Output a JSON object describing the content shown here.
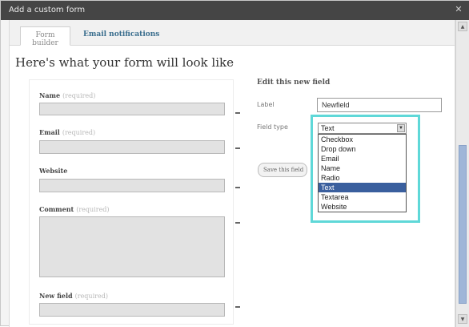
{
  "window": {
    "title": "Add a custom form",
    "close_glyph": "✕"
  },
  "tabs": [
    {
      "label": "Form builder"
    },
    {
      "label": "Email notifications"
    }
  ],
  "preview": {
    "heading": "Here's what your form will look like",
    "fields": [
      {
        "label": "Name",
        "required_text": "(required)"
      },
      {
        "label": "Email",
        "required_text": "(required)"
      },
      {
        "label": "Website",
        "required_text": ""
      },
      {
        "label": "Comment",
        "required_text": "(required)"
      },
      {
        "label": "New field",
        "required_text": "(required)"
      }
    ]
  },
  "editor": {
    "title": "Edit this new field",
    "label_caption": "Label",
    "label_value": "Newfield",
    "field_type_caption": "Field type",
    "field_type_selected": "Text",
    "field_type_options": [
      "Checkbox",
      "Drop down",
      "Email",
      "Name",
      "Radio",
      "Text",
      "Textarea",
      "Website"
    ],
    "save_button": "Save this field"
  },
  "icons": {
    "dropdown_arrow": "▼",
    "scroll_up": "▲",
    "scroll_down": "▼"
  },
  "colors": {
    "highlight_border": "#5fd8d8",
    "selected_option": "#3a5f9e",
    "titlebar": "#454545"
  }
}
